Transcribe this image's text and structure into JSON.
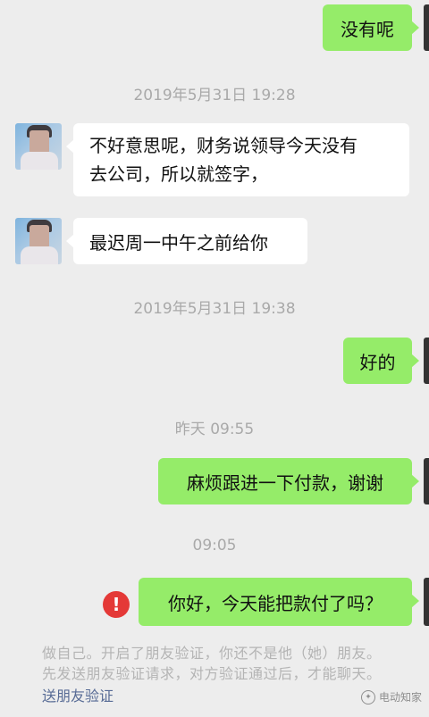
{
  "messages": {
    "m1": "没有呢",
    "t1": "2019年5月31日 19:28",
    "m2_line1": "不好意思呢，财务说领导今天没有",
    "m2_line2": "去公司，所以就签字，",
    "m3": "最迟周一中午之前给你",
    "t2": "2019年5月31日 19:38",
    "m4": "好的",
    "t3": "昨天 09:55",
    "m5": "麻烦跟进一下付款，谢谢",
    "t4": "09:05",
    "m6": "你好，今天能把款付了吗？"
  },
  "error_icon": "!",
  "notice": {
    "line1": "做自己。开启了朋友验证，你还不是他（她）朋友。",
    "line2": "先发送朋友验证请求，对方验证通过后，才能聊天。",
    "link": "送朋友验证"
  },
  "watermark": "电动知家",
  "colors": {
    "outgoing_bubble": "#95ec69",
    "incoming_bubble": "#ffffff",
    "background": "#ededed",
    "error": "#e43937",
    "link": "#576b95"
  }
}
